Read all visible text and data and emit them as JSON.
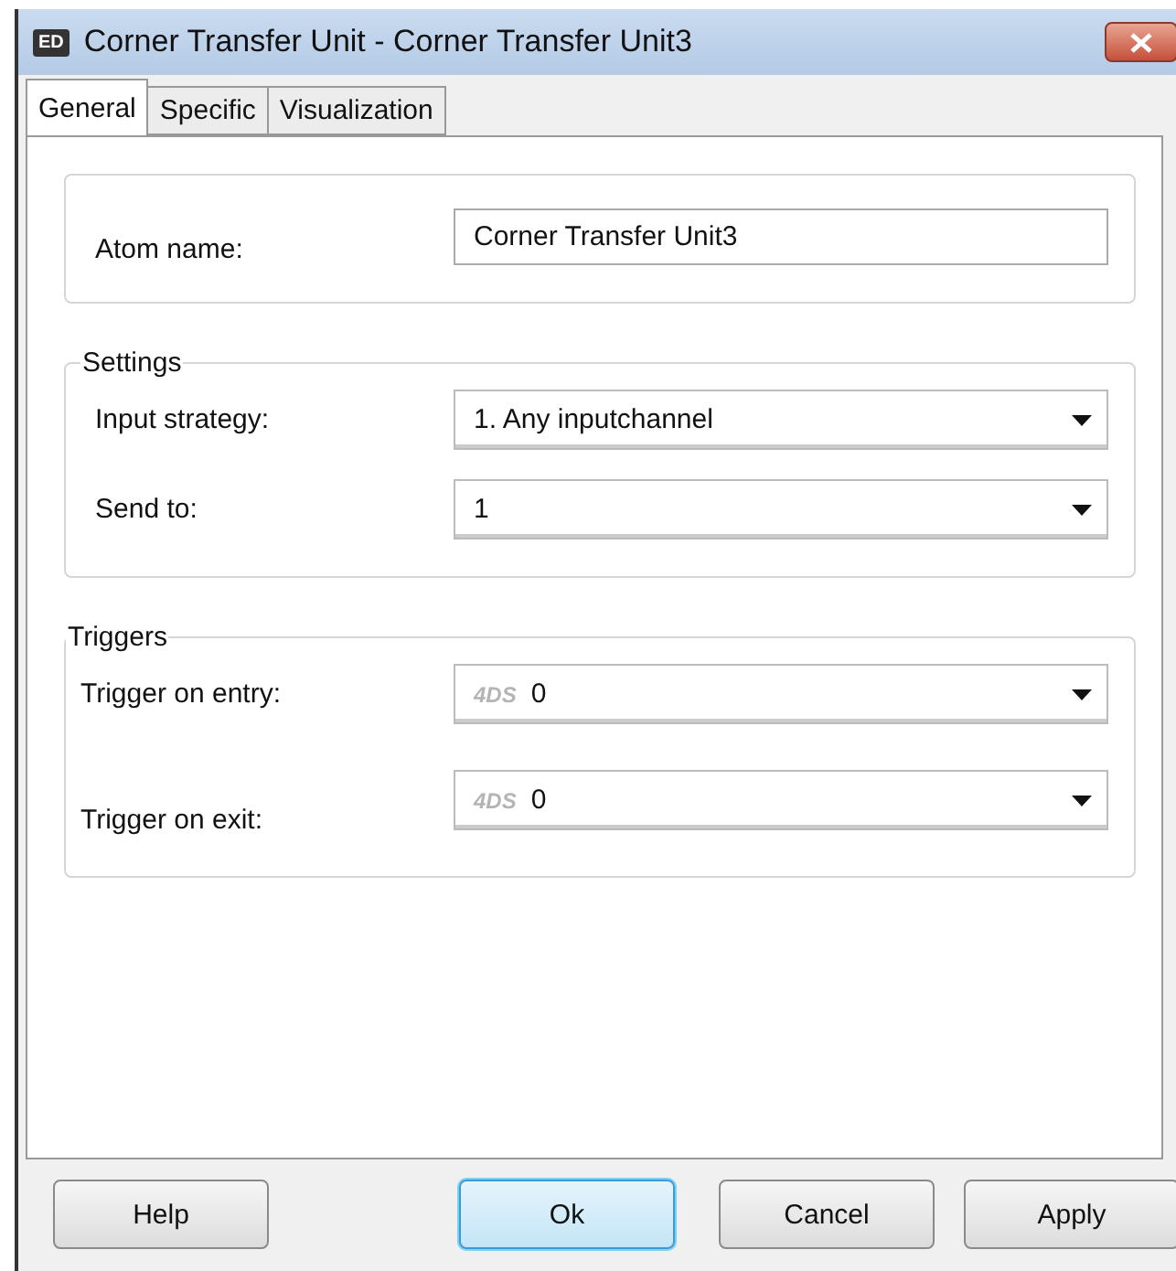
{
  "window": {
    "icon_text": "ED",
    "title": "Corner Transfer Unit - Corner Transfer Unit3"
  },
  "tabs": [
    {
      "label": "General",
      "selected": true
    },
    {
      "label": "Specific",
      "selected": false
    },
    {
      "label": "Visualization",
      "selected": false
    }
  ],
  "atom": {
    "label": "Atom name:",
    "value": "Corner Transfer Unit3"
  },
  "settings": {
    "title": "Settings",
    "fields": [
      {
        "label": "Input strategy:",
        "value": "1. Any inputchannel"
      },
      {
        "label": "Send to:",
        "value": "1"
      }
    ]
  },
  "triggers": {
    "title": "Triggers",
    "fields": [
      {
        "label": "Trigger on entry:",
        "prefix": "4DS",
        "value": "0"
      },
      {
        "label": "Trigger on exit:",
        "prefix": "4DS",
        "value": "0"
      }
    ]
  },
  "buttons": [
    {
      "label": "Help",
      "default": false
    },
    {
      "label": "Ok",
      "default": true
    },
    {
      "label": "Cancel",
      "default": false
    },
    {
      "label": "Apply",
      "default": false
    }
  ]
}
